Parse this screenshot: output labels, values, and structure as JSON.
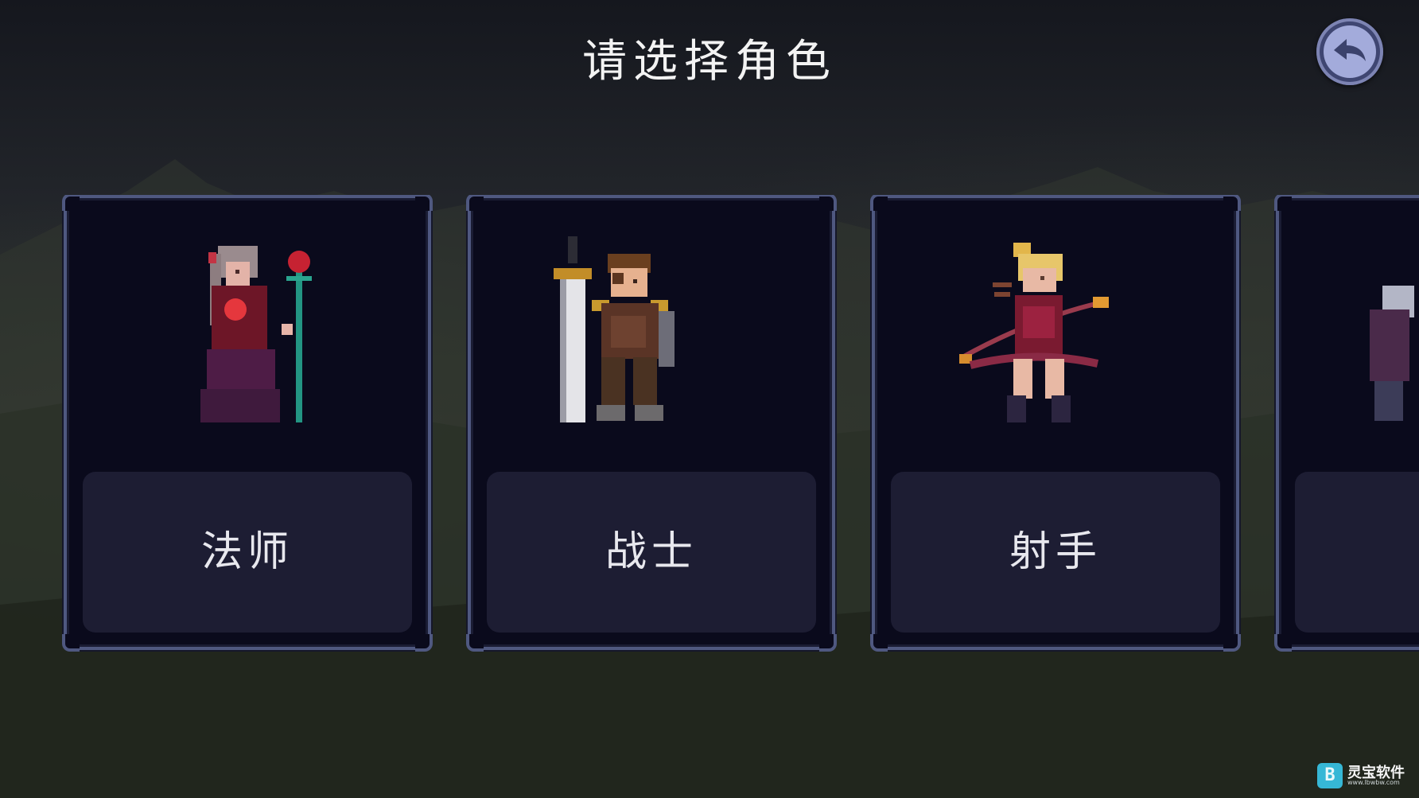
{
  "title": "请选择角色",
  "back_button": {
    "icon": "back-arrow-icon"
  },
  "characters": [
    {
      "name": "法师",
      "sprite": "mage-sprite"
    },
    {
      "name": "战士",
      "sprite": "warrior-sprite"
    },
    {
      "name": "射手",
      "sprite": "archer-sprite"
    },
    {
      "name": "",
      "sprite": "partial-character-sprite"
    }
  ],
  "watermark": {
    "text": "灵宝软件",
    "url": "www.lbwbw.com",
    "icon_glyph": "B"
  },
  "colors": {
    "card_bg": "#0a0a1c",
    "card_border": "#4f5880",
    "label_bg": "#1d1d33",
    "back_button": "#a3abdb"
  }
}
